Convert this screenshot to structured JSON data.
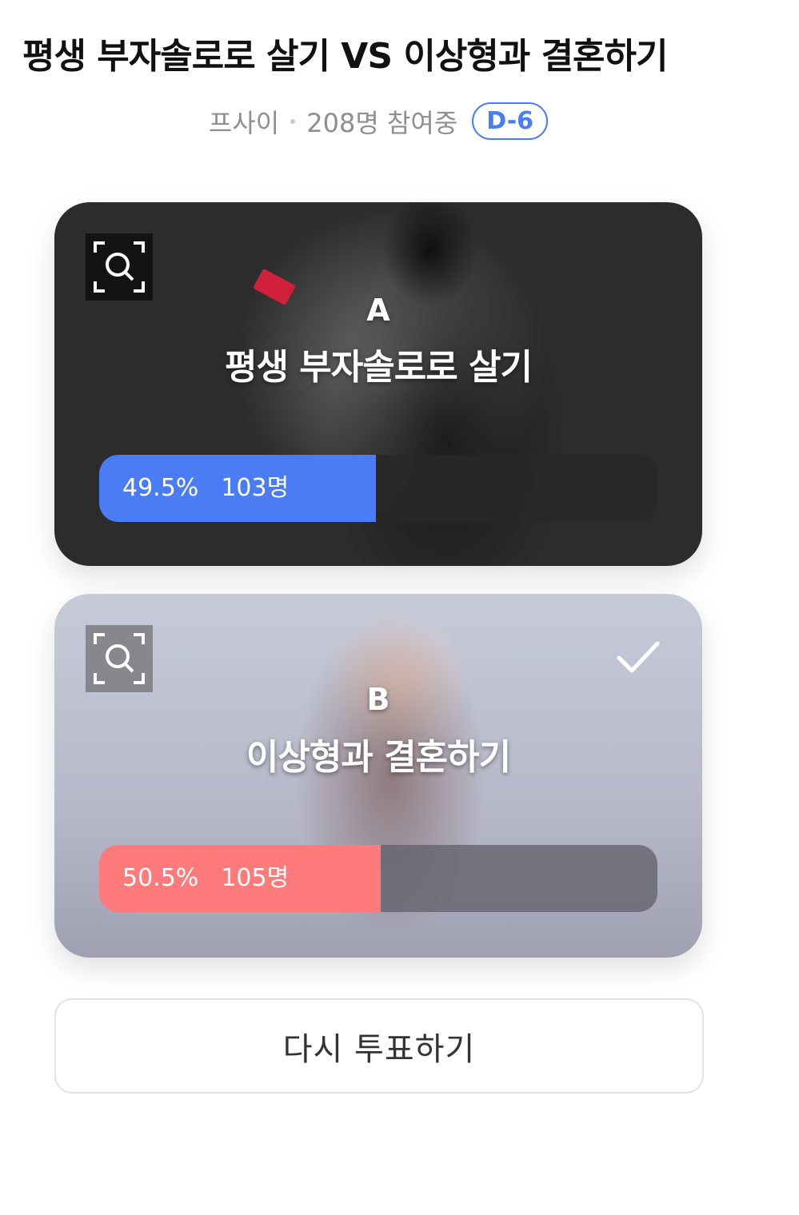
{
  "poll": {
    "title": "평생 부자솔로로 살기 VS 이상형과 결혼하기",
    "author": "프사이",
    "participants": "208명 참여중",
    "deadline_badge": "D-6"
  },
  "options": [
    {
      "letter": "A",
      "text": "평생 부자솔로로 살기",
      "percent_label": "49.5%",
      "count_label": "103명",
      "percent": 49.5,
      "bar_color": "#4a7cf5",
      "selected": false
    },
    {
      "letter": "B",
      "text": "이상형과 결혼하기",
      "percent_label": "50.5%",
      "count_label": "105명",
      "percent": 50.5,
      "bar_color": "#ff7b7b",
      "selected": true
    }
  ],
  "actions": {
    "revote_label": "다시 투표하기"
  },
  "icons": {
    "image_zoom": "image-search-icon",
    "selected": "checkmark-icon"
  }
}
